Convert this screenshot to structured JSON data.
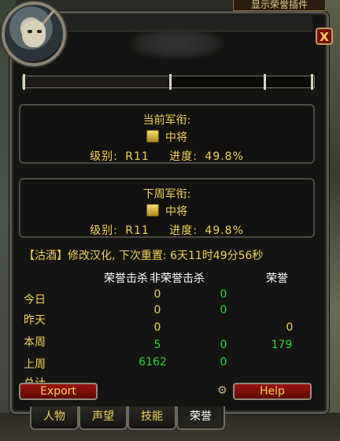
{
  "addon_title": "显示荣誉插件",
  "close_label": "X",
  "current_rank": {
    "title": "当前军衔:",
    "rank_name": "中将",
    "level_label": "级别:",
    "level_value": "R11",
    "progress_label": "进度:",
    "progress_value": "49.8%"
  },
  "next_rank": {
    "title": "下周军衔:",
    "rank_name": "中将",
    "level_label": "级别:",
    "level_value": "R11",
    "progress_label": "进度:",
    "progress_value": "49.8%"
  },
  "reset_line": "【沽酒】修改汉化, 下次重置: 6天11时49分56秒",
  "table": {
    "headers": [
      "荣誉击杀",
      "非荣誉击杀",
      "荣誉"
    ],
    "rows": [
      {
        "label": "今日",
        "hk": "0",
        "dk": "0",
        "honor": ""
      },
      {
        "label": "昨天",
        "hk": "0",
        "dk": "0",
        "honor": ""
      },
      {
        "label": "本周",
        "hk": "0",
        "dk": "",
        "honor": "0"
      },
      {
        "label": "上周",
        "hk": "5",
        "dk": "0",
        "honor": "179"
      },
      {
        "label": "总计",
        "hk": "6162",
        "dk": "0",
        "honor": ""
      }
    ]
  },
  "buttons": {
    "export": "Export",
    "help": "Help"
  },
  "tabs": [
    "人物",
    "声望",
    "技能",
    "荣誉"
  ],
  "active_tab": "荣誉",
  "colors": {
    "gold": "#f1d25a",
    "green": "#27d833",
    "button_red": "#9b130d"
  },
  "progress_fraction": 0.498
}
